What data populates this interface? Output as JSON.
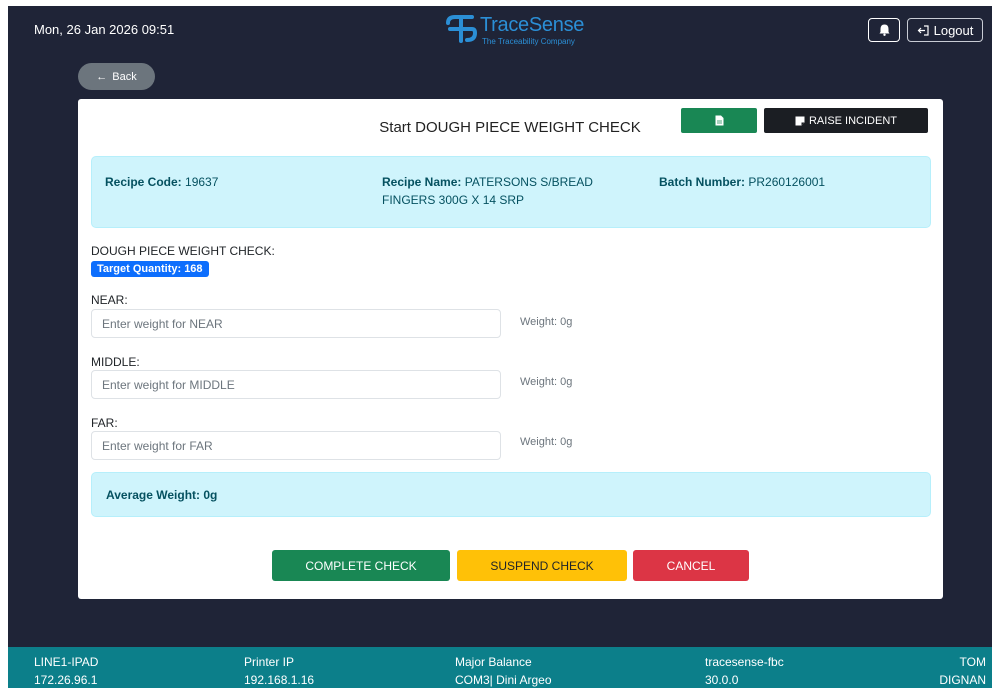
{
  "header": {
    "datetime": "Mon, 26 Jan 2026 09:51",
    "logo_name": "TraceSense",
    "logo_tagline": "The Traceability Company",
    "logout_label": "Logout",
    "back_label": "Back"
  },
  "card": {
    "title": "Start DOUGH PIECE WEIGHT CHECK",
    "incident_label": "RAISE INCIDENT",
    "recipe_code_label": "Recipe Code:",
    "recipe_code": "19637",
    "recipe_name_label": "Recipe Name:",
    "recipe_name": "PATERSONS S/BREAD FINGERS 300G X 14 SRP",
    "batch_label": "Batch Number:",
    "batch_number": "PR260126001",
    "section_label": "DOUGH PIECE WEIGHT CHECK:",
    "target_badge": "Target Quantity: 168",
    "fields": [
      {
        "label": "NEAR:",
        "placeholder": "Enter weight for NEAR",
        "value": "",
        "weight": "Weight: 0g"
      },
      {
        "label": "MIDDLE:",
        "placeholder": "Enter weight for MIDDLE",
        "value": "",
        "weight": "Weight: 0g"
      },
      {
        "label": "FAR:",
        "placeholder": "Enter weight for FAR",
        "value": "",
        "weight": "Weight: 0g"
      }
    ],
    "average": "Average Weight: 0g",
    "complete_label": "COMPLETE CHECK",
    "suspend_label": "SUSPEND CHECK",
    "cancel_label": "CANCEL"
  },
  "footer": {
    "device_name": "LINE1-IPAD",
    "device_ip": "172.26.96.1",
    "printer_label": "Printer IP",
    "printer_ip": "192.168.1.16",
    "balance_label": "Major Balance",
    "balance_value": "COM3| Dini Argeo",
    "server_name": "tracesense-fbc",
    "server_version": "30.0.0",
    "user_first": "TOM",
    "user_last": "DIGNAN"
  },
  "colors": {
    "background": "#1f2437",
    "primary": "#0d6efd",
    "success": "#198754",
    "warning": "#ffc107",
    "danger": "#dc3545",
    "info_bg": "#cff4fc",
    "footer": "#0c7f8a"
  },
  "icons": [
    "logo-icon",
    "bell-icon",
    "logout-icon",
    "arrow-left-icon",
    "document-icon",
    "incident-icon"
  ]
}
